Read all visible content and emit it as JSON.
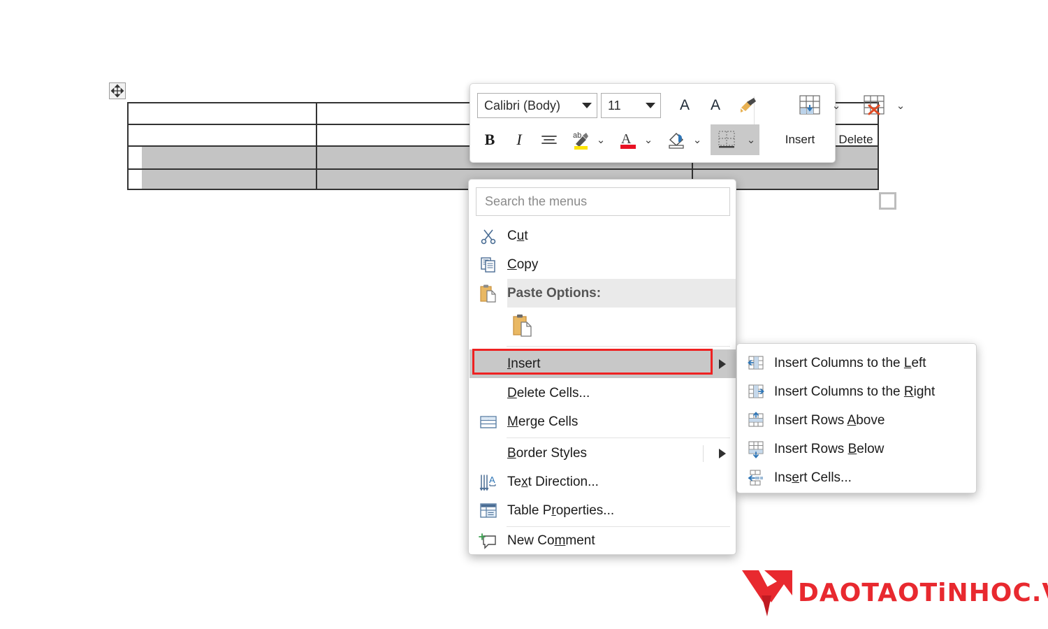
{
  "document": {
    "table": {
      "rows": 4,
      "columns": 3,
      "selected_rows": [
        3,
        4
      ],
      "move_handle_icon": "move-cross-icon",
      "resize_handle_icon": "resize-square-icon"
    }
  },
  "mini_toolbar": {
    "font_name": "Calibri (Body)",
    "font_size": "11",
    "grow_font_label": "A",
    "shrink_font_label": "A",
    "format_painter_icon": "format-painter-icon",
    "bold_label": "B",
    "italic_label": "I",
    "align_icon": "align-center-icon",
    "highlight_icon": "text-highlight-icon",
    "font_color_icon": "font-color-icon",
    "shading_icon": "shading-icon",
    "borders_icon": "borders-icon",
    "insert_label": "Insert",
    "delete_label": "Delete",
    "insert_icon": "insert-table-icon",
    "delete_icon": "delete-table-icon",
    "accent_blue": "#2e75b6",
    "highlight_yellow": "#ffe400",
    "font_color_red": "#e81123"
  },
  "context_menu": {
    "search": {
      "placeholder": "Search the menus",
      "value": ""
    },
    "items": [
      {
        "label": "Cut",
        "accel": "t",
        "icon": "scissors-icon",
        "type": "item"
      },
      {
        "label": "Copy",
        "accel": "C",
        "icon": "copy-icon",
        "type": "item"
      },
      {
        "label": "Paste Options:",
        "icon": "clipboard-icon",
        "type": "header"
      },
      {
        "label": "",
        "icon": "paste-keep-source-icon",
        "type": "gallery"
      },
      {
        "label": "Insert",
        "accel": "I",
        "icon": "",
        "type": "submenu",
        "state": "selected"
      },
      {
        "label": "Delete Cells...",
        "accel": "D",
        "icon": "",
        "type": "item"
      },
      {
        "label": "Merge Cells",
        "accel": "M",
        "icon": "merge-cells-icon",
        "type": "item"
      },
      {
        "label": "Border Styles",
        "accel": "B",
        "icon": "",
        "type": "submenu"
      },
      {
        "label": "Text Direction...",
        "accel": "x",
        "icon": "text-direction-icon",
        "type": "item"
      },
      {
        "label": "Table Properties...",
        "accel": "r",
        "icon": "table-properties-icon",
        "type": "item"
      },
      {
        "label": "New Comment",
        "accel": "m",
        "icon": "new-comment-icon",
        "type": "item"
      }
    ]
  },
  "insert_submenu": {
    "items": [
      {
        "label": "Insert Columns to the Left",
        "accel": "L",
        "icon": "insert-columns-left-icon"
      },
      {
        "label": "Insert Columns to the Right",
        "accel": "R",
        "icon": "insert-columns-right-icon"
      },
      {
        "label": "Insert Rows Above",
        "accel": "A",
        "icon": "insert-rows-above-icon"
      },
      {
        "label": "Insert Rows Below",
        "accel": "B",
        "icon": "insert-rows-below-icon"
      },
      {
        "label": "Insert Cells...",
        "accel": "e",
        "icon": "insert-cells-icon"
      }
    ]
  },
  "annotation": {
    "highlight_color": "#ee2222",
    "target": "Insert"
  },
  "watermark": {
    "text": "DAOTAOTiNHOC.VN",
    "color": "#e8292f",
    "mark_icon": "v-arrow-logo-icon"
  }
}
